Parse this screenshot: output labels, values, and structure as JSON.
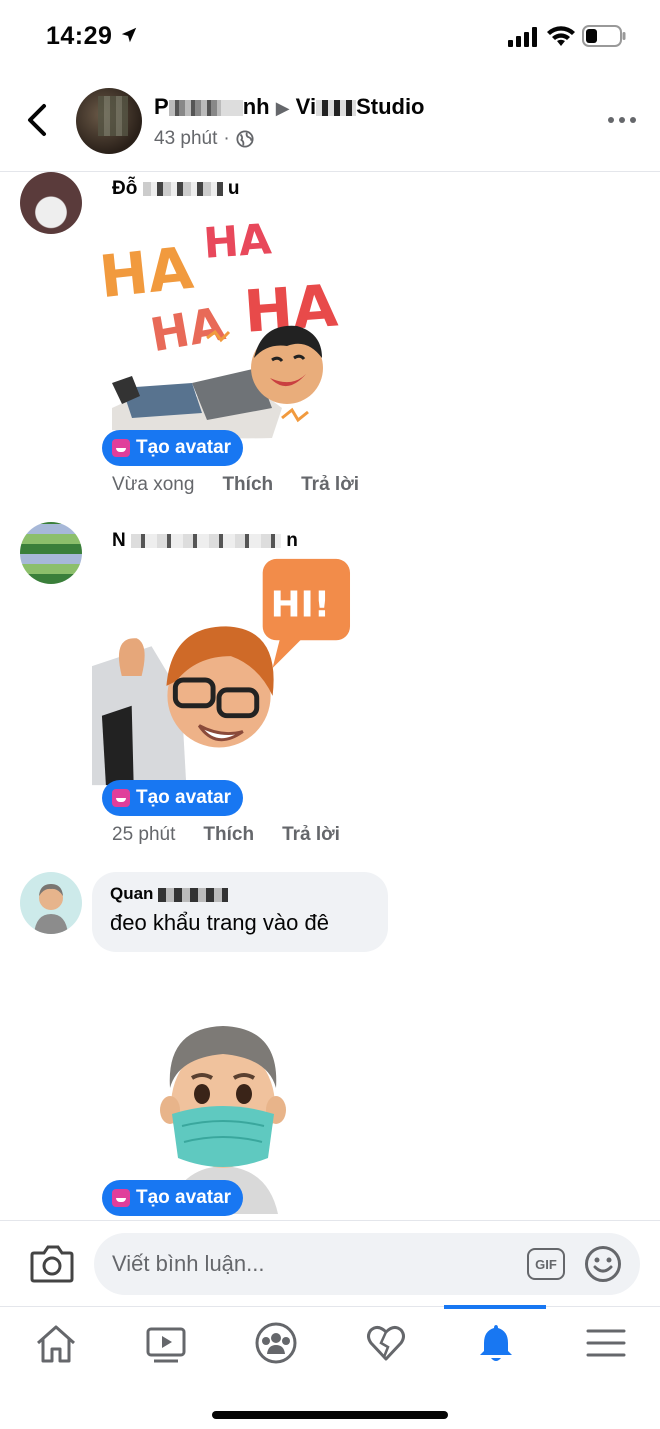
{
  "status_bar": {
    "time": "14:29"
  },
  "header": {
    "title_visible_1": "P",
    "title_visible_2": "nh",
    "title_separator": "▶",
    "title_visible_3": "Vi",
    "title_visible_4": "Studio",
    "time": "43 phút",
    "dot": "·",
    "privacy_icon": "globe-icon"
  },
  "comments": [
    {
      "name_visible_1": "Đỗ",
      "name_visible_2": "u",
      "sticker_words": [
        "HA",
        "HA",
        "HA",
        "HA"
      ],
      "create_avatar_label": "Tạo avatar",
      "time": "Vừa xong",
      "like_label": "Thích",
      "reply_label": "Trả lời"
    },
    {
      "name_visible_1": "N",
      "name_visible_2": "n",
      "sticker_words": [
        "HI!"
      ],
      "create_avatar_label": "Tạo avatar",
      "time": "25 phút",
      "like_label": "Thích",
      "reply_label": "Trả lời"
    },
    {
      "name_visible_1": "Quan",
      "text": "đeo khẩu trang vào đê",
      "create_avatar_label": "Tạo avatar"
    }
  ],
  "composer": {
    "placeholder": "Viết bình luận...",
    "gif_label": "GIF"
  },
  "tabs": [
    "home-icon",
    "video-icon",
    "groups-icon",
    "dating-heart-icon",
    "notifications-bell-icon",
    "menu-icon"
  ],
  "colors": {
    "accent": "#1877f2",
    "secondary_text": "#65676b",
    "bubble": "#f0f2f5"
  }
}
